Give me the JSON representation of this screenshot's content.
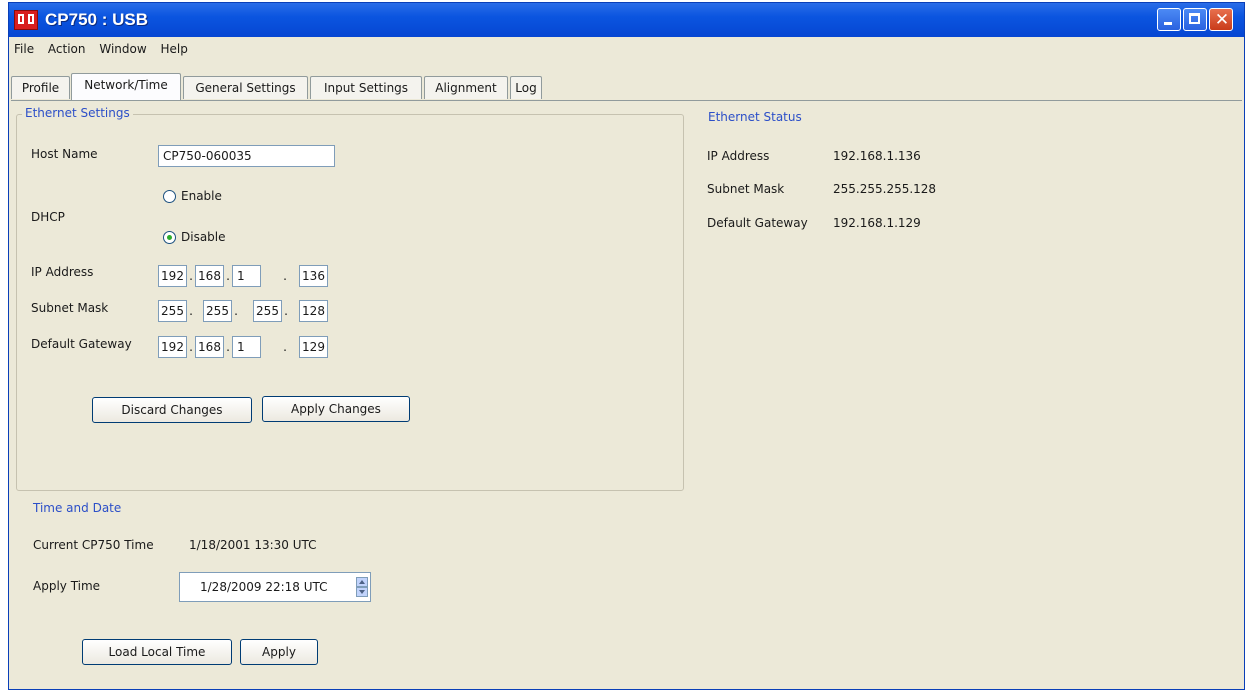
{
  "window": {
    "title": "CP750 : USB"
  },
  "menu": [
    "File",
    "Action",
    "Window",
    "Help"
  ],
  "tabs": [
    "Profile",
    "Network/Time",
    "General Settings",
    "Input Settings",
    "Alignment",
    "Log"
  ],
  "active_tab": "Network/Time",
  "ethernet_settings": {
    "title": "Ethernet Settings",
    "host_name_label": "Host Name",
    "host_name_value": "CP750-060035",
    "dhcp_label": "DHCP",
    "enable_label": "Enable",
    "disable_label": "Disable",
    "dhcp_selected": "Disable",
    "ip_label": "IP Address",
    "ip": [
      "192",
      "168",
      "1",
      "136"
    ],
    "subnet_label": "Subnet Mask",
    "subnet": [
      "255",
      "255",
      "255",
      "128"
    ],
    "gateway_label": "Default Gateway",
    "gateway": [
      "192",
      "168",
      "1",
      "129"
    ],
    "discard_label": "Discard Changes",
    "apply_label": "Apply Changes"
  },
  "ethernet_status": {
    "title": "Ethernet Status",
    "ip_label": "IP Address",
    "ip_value": "192.168.1.136",
    "subnet_label": "Subnet Mask",
    "subnet_value": "255.255.255.128",
    "gateway_label": "Default Gateway",
    "gateway_value": "192.168.1.129"
  },
  "time_date": {
    "title": "Time and Date",
    "current_label": "Current CP750 Time",
    "current_value": "1/18/2001 13:30 UTC",
    "apply_time_label": "Apply Time",
    "apply_time_value": "1/28/2009 22:18 UTC",
    "load_local_label": "Load Local Time",
    "apply_label": "Apply"
  },
  "colors": {
    "title_bar": "#0b55e0",
    "group_title": "#2c4fc8",
    "window_bg": "#ece9d8"
  }
}
